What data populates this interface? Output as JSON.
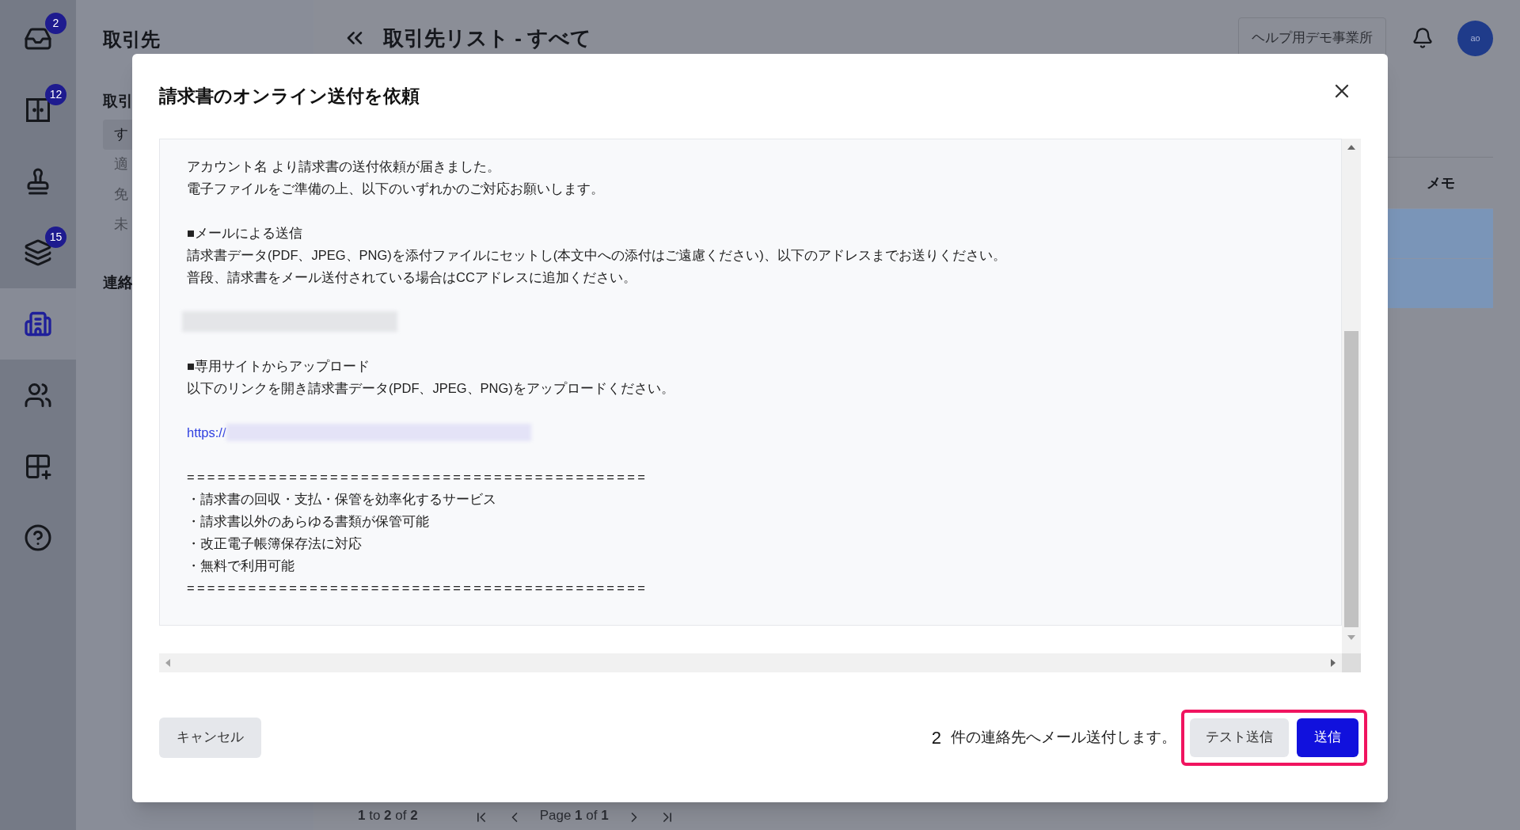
{
  "rail": [
    {
      "badge": "2",
      "selected": false
    },
    {
      "badge": "12",
      "selected": false
    },
    {
      "selected": false
    },
    {
      "badge": "15",
      "selected": false
    },
    {
      "selected": true
    },
    {
      "selected": false
    },
    {
      "selected": false
    },
    {
      "selected": false
    }
  ],
  "sidebar": {
    "title": "取引先",
    "sections": [
      {
        "label": "取引",
        "items": [
          {
            "label": "す",
            "selected": true
          },
          {
            "label": "適",
            "selected": false
          },
          {
            "label": "免",
            "selected": false
          },
          {
            "label": "未",
            "selected": false
          }
        ]
      },
      {
        "label": "連絡"
      }
    ]
  },
  "header": {
    "title": "取引先リスト - すべて",
    "office_button": "ヘルプ用デモ事業所",
    "avatar": "ao"
  },
  "table": {
    "columns": [
      "メモ"
    ],
    "rows": [
      {
        "selected": true
      },
      {
        "selected": true
      }
    ]
  },
  "pagination": {
    "range": "**1** to **2** of **2**",
    "page": "Page **1** of **1**"
  },
  "dialog": {
    "title": "請求書のオンライン送付を依頼",
    "body": [
      {
        "kind": "text",
        "text": "アカウント名 より請求書の送付依頼が届きました。"
      },
      {
        "kind": "text",
        "text": "電子ファイルをご準備の上、以下のいずれかのご対応お願いします。"
      },
      {
        "kind": "blank"
      },
      {
        "kind": "text",
        "text": "■メールによる送信"
      },
      {
        "kind": "text",
        "text": "請求書データ(PDF、JPEG、PNG)を添付ファイルにセットし(本文中への添付はご遠慮ください)、以下のアドレスまでお送りください。"
      },
      {
        "kind": "text",
        "text": "普段、請求書をメール送付されている場合はCCアドレスに追加ください。"
      },
      {
        "kind": "blank"
      },
      {
        "kind": "redacted"
      },
      {
        "kind": "blank"
      },
      {
        "kind": "text",
        "text": "■専用サイトからアップロード"
      },
      {
        "kind": "text",
        "text": "以下のリンクを開き請求書データ(PDF、JPEG、PNG)をアップロードください。"
      },
      {
        "kind": "blank"
      },
      {
        "kind": "link",
        "text": "https://"
      },
      {
        "kind": "blank"
      },
      {
        "kind": "rule",
        "text": "============================================="
      },
      {
        "kind": "text",
        "text": "・請求書の回収・支払・保管を効率化するサービス"
      },
      {
        "kind": "text",
        "text": "・請求書以外のあらゆる書類が保管可能"
      },
      {
        "kind": "text",
        "text": "・改正電子帳簿保存法に対応"
      },
      {
        "kind": "text",
        "text": "・無料で利用可能"
      },
      {
        "kind": "rule",
        "text": "============================================="
      }
    ],
    "cancel": "キャンセル",
    "count": "2",
    "summary": "件の連絡先へメール送付します。",
    "test_button": "テスト送信",
    "send_button": "送信",
    "highlighted": true
  }
}
